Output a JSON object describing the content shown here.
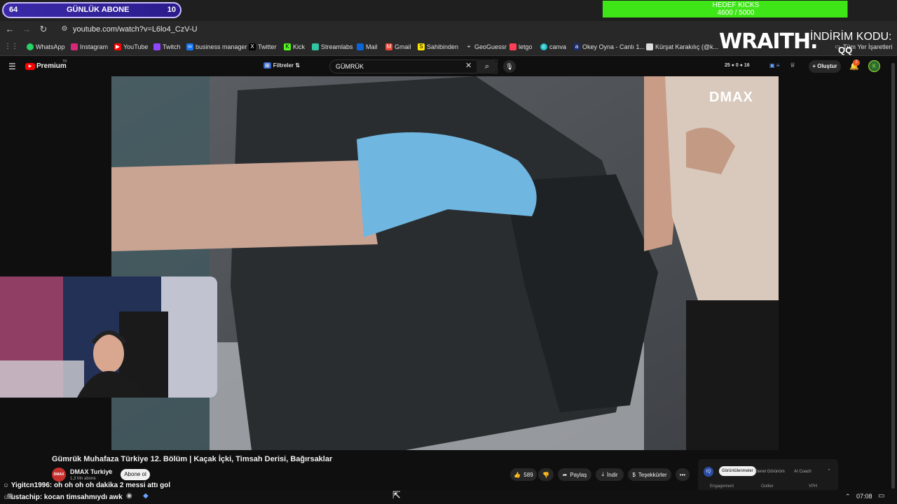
{
  "overlay": {
    "abone_left": "64",
    "abone_label": "GÜNLÜK ABONE",
    "abone_right": "10",
    "hedef_title": "HEDEF KICKS",
    "hedef_progress": "4600 / 5000",
    "hedef_fraction": 0.92,
    "brand": "WRAITH.",
    "indirim": "İNDİRİM KODU:",
    "code": "QQ"
  },
  "browser": {
    "url": "youtube.com/watch?v=L6lo4_CzV-U",
    "bookmarks": [
      "WhatsApp",
      "Instagram",
      "YouTube",
      "Twitch",
      "business manager",
      "Twitter",
      "Kick",
      "Streamlabs",
      "Mail",
      "Gmail",
      "Sahibinden",
      "GeoGuessr",
      "letgo",
      "canva",
      "Okey Oyna - Canlı 1...",
      "Kürşat Karakılıç (@k...",
      "Tüm Yer İşaretleri"
    ]
  },
  "youtube": {
    "logo": "Premium",
    "logo_sup": "TR",
    "filters": "Filtreler",
    "search_value": "GÜMRÜK",
    "stats": "25 ● 0 ● 16",
    "create": "Oluştur",
    "notif_count": "2",
    "watermark": "DMAX",
    "video_title": "Gümrük Muhafaza Türkiye 12. Bölüm | Kaçak İçki, Timsah Derisi, Bağırsaklar",
    "channel": "DMAX Turkiye",
    "subs": "1,3 Mn abone",
    "subscribe": "Abone ol",
    "likes": "589",
    "share": "Paylaş",
    "download": "İndir",
    "thanks": "Teşekkürler",
    "more": "•••",
    "panel_tabs": [
      "Görüntülenmeler",
      "Genel Görünüm",
      "AI Coach"
    ],
    "panel_cols": [
      "Engagement",
      "Outlier",
      "VPH"
    ]
  },
  "chat": [
    {
      "user": "Yigitcn1996",
      "msg": ": oh oh oh oh dakika 2 messi attı gol"
    },
    {
      "user": "ustachip",
      "msg": ": kocan timsahmıydı awk"
    }
  ],
  "taskbar": {
    "time": "07:08"
  }
}
